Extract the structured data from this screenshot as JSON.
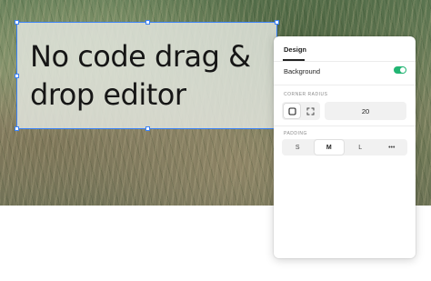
{
  "canvas": {
    "headline": "No code drag & drop editor",
    "selection_color": "#3b82f6"
  },
  "panel": {
    "tab_label": "Design",
    "background_label": "Background",
    "background_enabled": true,
    "toggle_color": "#22b573",
    "corner_radius": {
      "title": "CORNER RADIUS",
      "value": "20",
      "options": [
        {
          "icon": "square-corners-icon",
          "active": true
        },
        {
          "icon": "independent-corners-icon",
          "active": false
        }
      ]
    },
    "padding": {
      "title": "PADDING",
      "options": [
        {
          "label": "S",
          "active": false
        },
        {
          "label": "M",
          "active": true
        },
        {
          "label": "L",
          "active": false
        },
        {
          "label": "•••",
          "active": false
        }
      ]
    }
  }
}
